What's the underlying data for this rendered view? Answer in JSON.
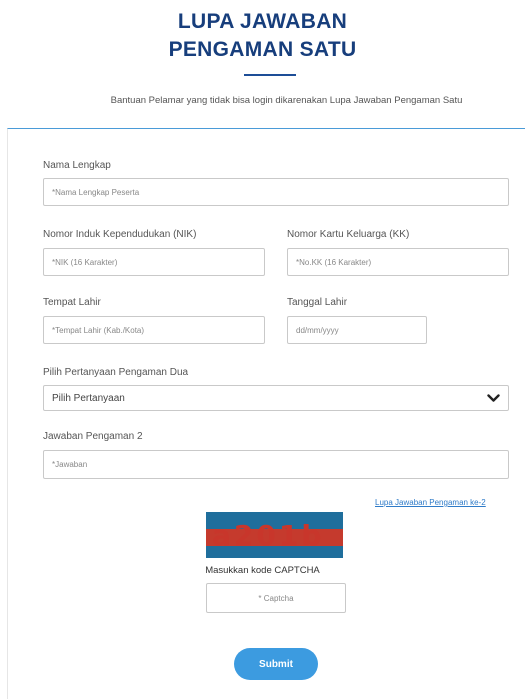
{
  "header": {
    "title_line1": "LUPA JAWABAN",
    "title_line2": "PENGAMAN SATU",
    "subtitle": "Bantuan Pelamar yang tidak bisa login dikarenakan Lupa Jawaban Pengaman Satu"
  },
  "form": {
    "nama_label": "Nama Lengkap",
    "nama_placeholder": "*Nama Lengkap Peserta",
    "nik_label": "Nomor Induk Kependudukan (NIK)",
    "nik_placeholder": "*NIK (16 Karakter)",
    "kk_label": "Nomor Kartu Keluarga (KK)",
    "kk_placeholder": "*No.KK (16 Karakter)",
    "tempat_label": "Tempat Lahir",
    "tempat_placeholder": "*Tempat Lahir (Kab./Kota)",
    "tanggal_label": "Tanggal Lahir",
    "tanggal_placeholder": "dd/mm/yyyy",
    "pertanyaan_label": "Pilih Pertanyaan Pengaman Dua",
    "pertanyaan_selected": "Pilih Pertanyaan",
    "jawaban_label": "Jawaban Pengaman 2",
    "jawaban_placeholder": "*Jawaban",
    "lupa_link": "Lupa Jawaban Pengaman ke-2",
    "captcha_image_text": "a201b",
    "captcha_label": "Masukkan kode CAPTCHA",
    "captcha_placeholder": "* Captcha",
    "submit_label": "Submit"
  },
  "colors": {
    "title": "#173e7c",
    "accent": "#3c9be0",
    "link": "#2f7bc8"
  },
  "icons": {
    "select_arrow": "chevron-down-icon"
  }
}
